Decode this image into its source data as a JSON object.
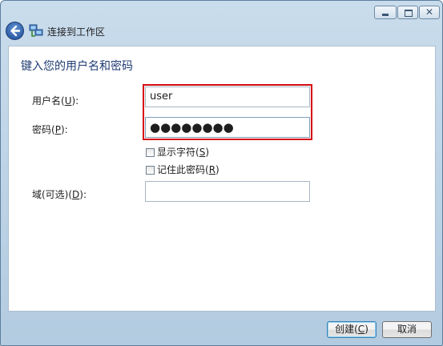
{
  "window": {
    "title": "连接到工作区"
  },
  "form": {
    "heading": "键入您的用户名和密码",
    "username": {
      "label_prefix": "用户名(",
      "label_key": "U",
      "label_suffix": "):",
      "value": "user"
    },
    "password": {
      "label_prefix": "密码(",
      "label_key": "P",
      "label_suffix": "):",
      "value": "●●●●●●●●"
    },
    "show_chars": {
      "label_prefix": "显示字符(",
      "label_key": "S",
      "label_suffix": ")",
      "checked": false
    },
    "remember": {
      "label_prefix": "记住此密码(",
      "label_key": "R",
      "label_suffix": ")",
      "checked": false
    },
    "domain": {
      "label_prefix": "域(可选)(",
      "label_key": "D",
      "label_suffix": "):",
      "value": ""
    }
  },
  "buttons": {
    "create": {
      "prefix": "创建(",
      "key": "C",
      "suffix": ")"
    },
    "cancel": "取消"
  },
  "colors": {
    "highlight": "#d60a12",
    "heading": "#1f3b72"
  },
  "icons": {
    "back": "back-arrow-icon",
    "network": "network-icon"
  }
}
